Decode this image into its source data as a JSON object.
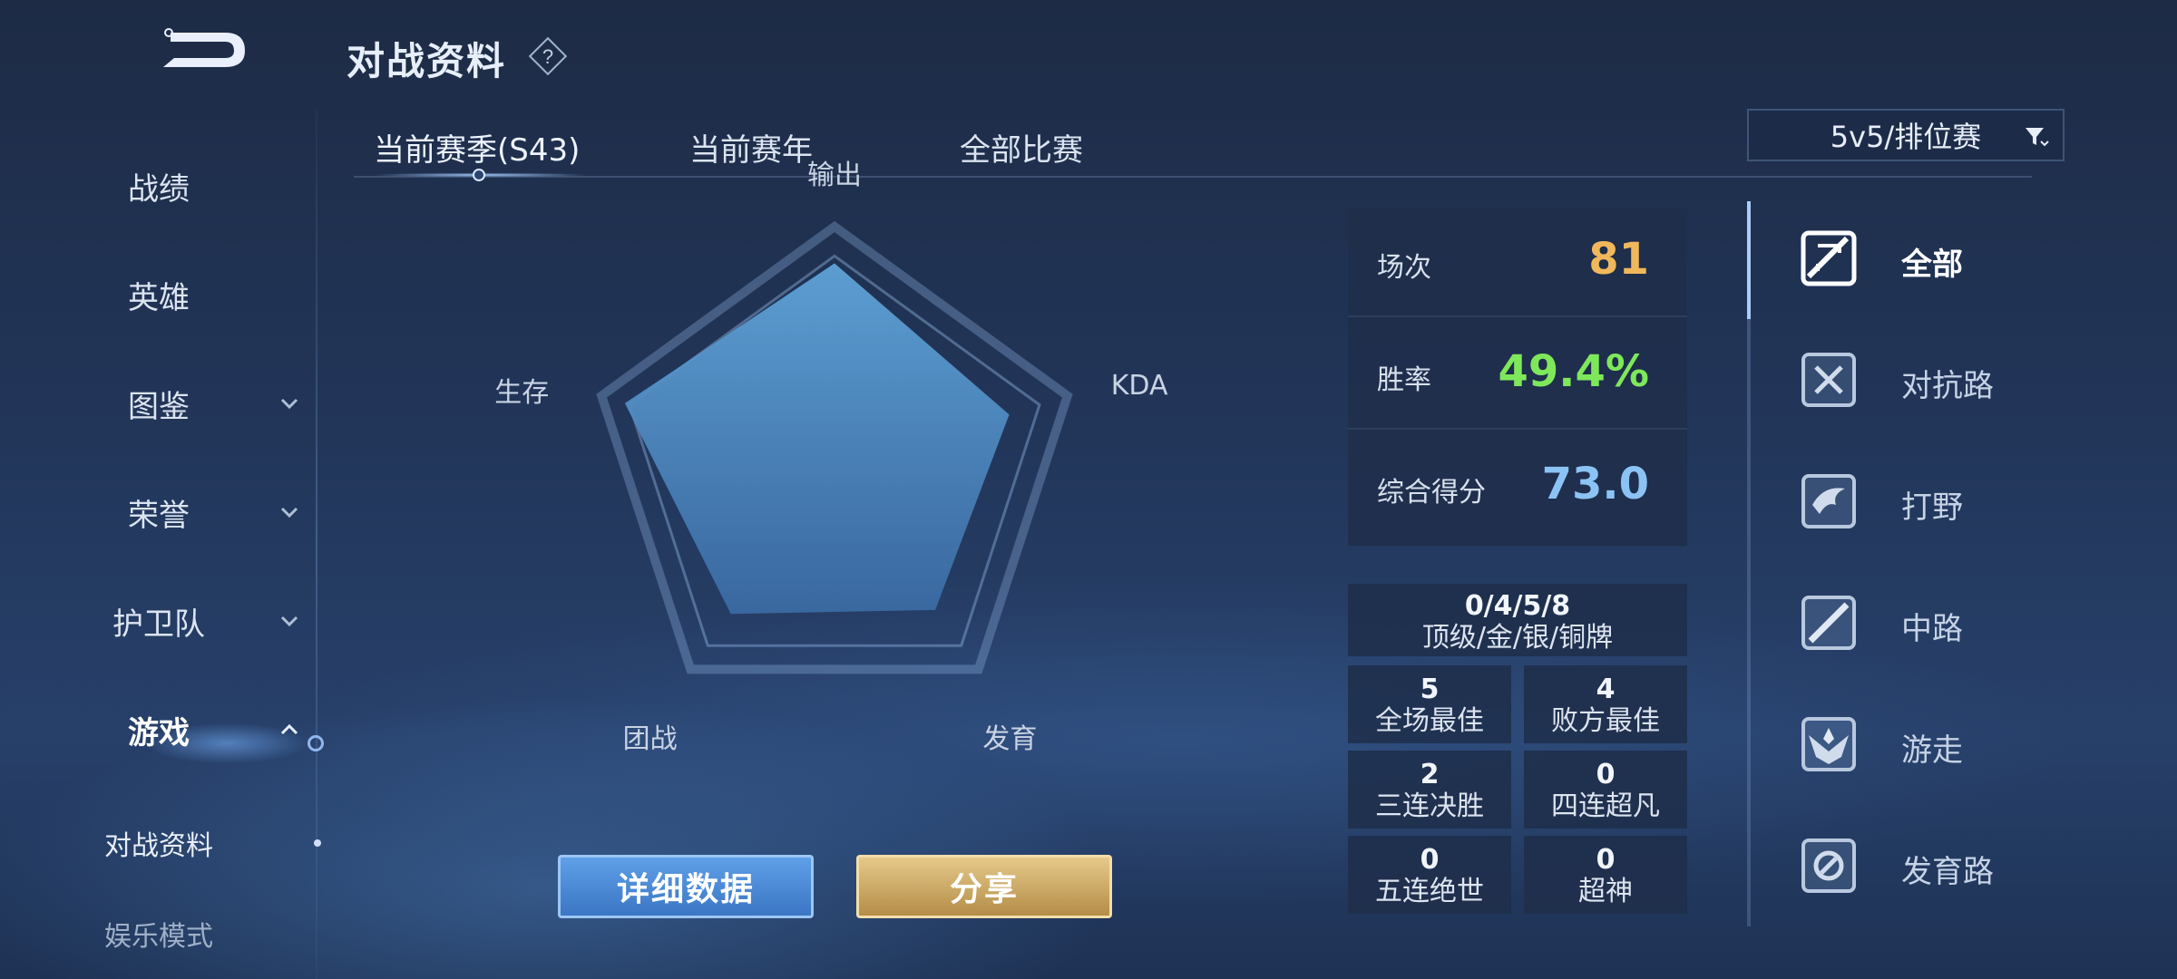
{
  "header": {
    "title": "对战资料"
  },
  "left_nav": {
    "items": [
      {
        "label": "战绩"
      },
      {
        "label": "英雄"
      },
      {
        "label": "图鉴"
      },
      {
        "label": "荣誉"
      },
      {
        "label": "护卫队"
      },
      {
        "label": "游戏"
      }
    ],
    "sub_items": [
      {
        "label": "对战资料"
      },
      {
        "label": "娱乐模式"
      }
    ]
  },
  "tabs": [
    {
      "label": "当前赛季(S43)"
    },
    {
      "label": "当前赛年"
    },
    {
      "label": "全部比赛"
    }
  ],
  "filter": {
    "label": "5v5/排位赛"
  },
  "radar": {
    "labels": [
      "输出",
      "KDA",
      "发育",
      "团战",
      "生存"
    ],
    "values": [
      0.85,
      0.75,
      0.7,
      0.72,
      0.9
    ]
  },
  "buttons": {
    "detail": "详细数据",
    "share": "分享"
  },
  "stats": {
    "games": {
      "label": "场次",
      "value": "81"
    },
    "win_rate": {
      "label": "胜率",
      "value": "49.4%"
    },
    "score": {
      "label": "综合得分",
      "value": "73.0"
    }
  },
  "medals": {
    "value": "0/4/5/8",
    "label": "顶级/金/银/铜牌"
  },
  "badges": [
    {
      "value": "5",
      "label": "全场最佳"
    },
    {
      "value": "4",
      "label": "败方最佳"
    },
    {
      "value": "2",
      "label": "三连决胜"
    },
    {
      "value": "0",
      "label": "四连超凡"
    },
    {
      "value": "0",
      "label": "五连绝世"
    },
    {
      "value": "0",
      "label": "超神"
    }
  ],
  "categories": [
    {
      "label": "全部",
      "icon": "all-lanes-icon"
    },
    {
      "label": "对抗路",
      "icon": "clash-lane-icon"
    },
    {
      "label": "打野",
      "icon": "jungle-icon"
    },
    {
      "label": "中路",
      "icon": "mid-lane-icon"
    },
    {
      "label": "游走",
      "icon": "roam-icon"
    },
    {
      "label": "发育路",
      "icon": "farm-lane-icon"
    }
  ],
  "colors": {
    "games": "#f0b85a",
    "win_rate": "#7ee85a",
    "score": "#8cc3f5"
  }
}
